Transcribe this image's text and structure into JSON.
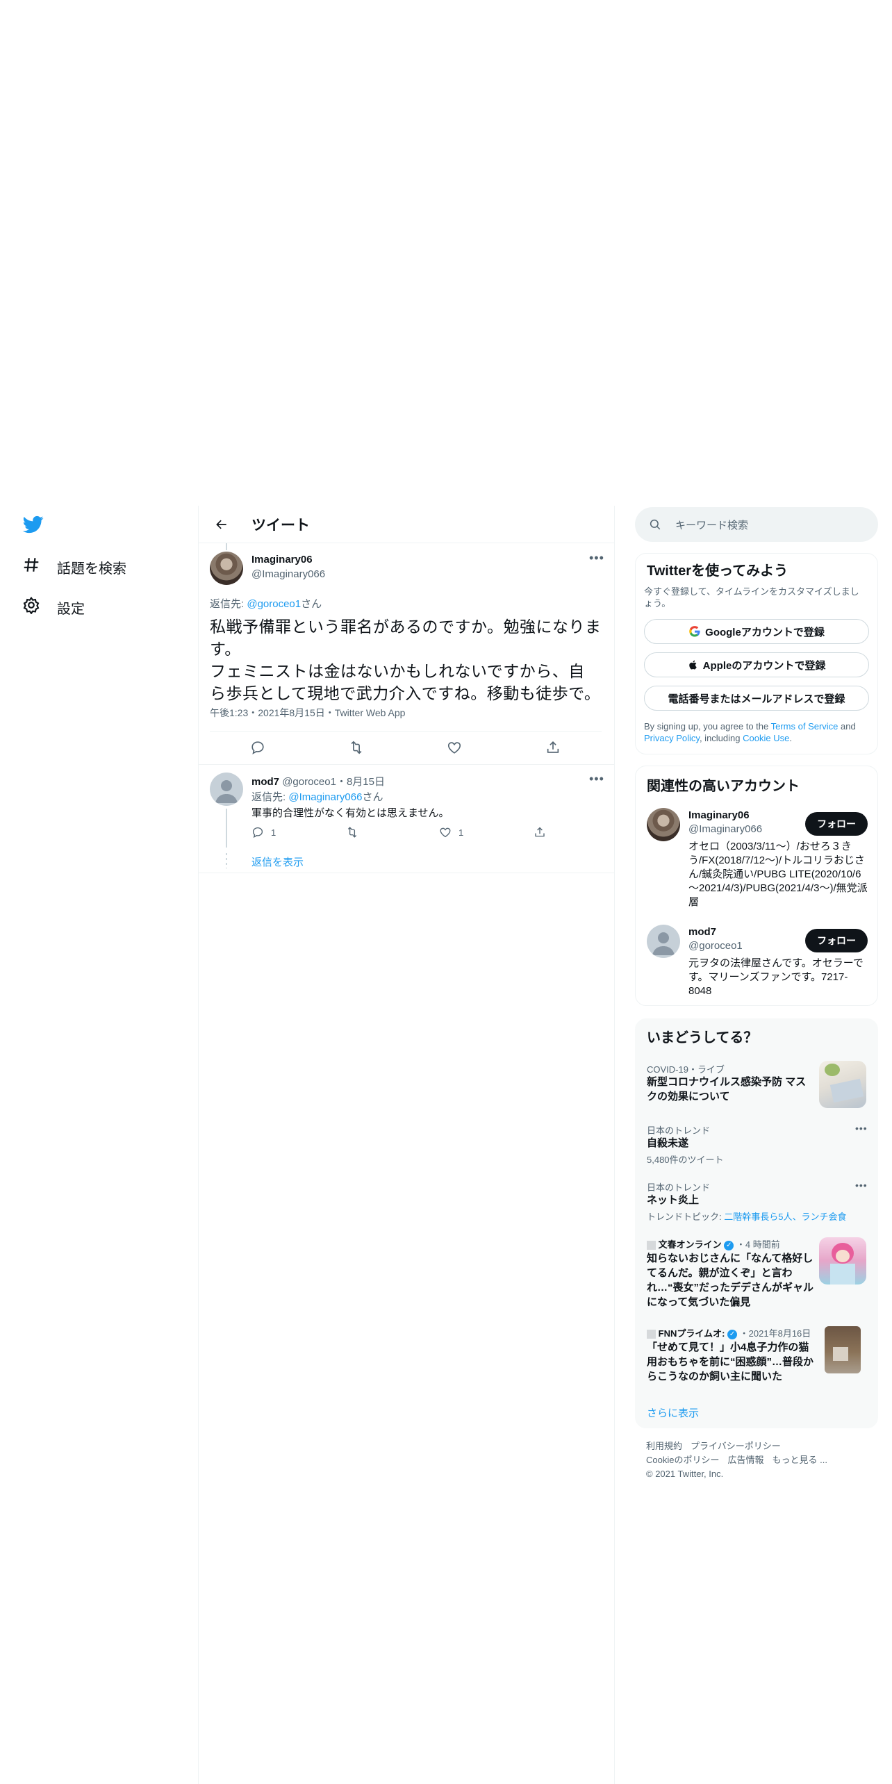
{
  "nav": {
    "explore_label": "話題を検索",
    "settings_label": "設定"
  },
  "header": {
    "title": "ツイート"
  },
  "main_tweet": {
    "display_name": "Imaginary06",
    "handle": "@Imaginary066",
    "reply_prefix": "返信先: ",
    "reply_to": "@goroceo1",
    "reply_suffix": "さん",
    "text_line1": "私戦予備罪という罪名があるのですか。勉強になりま",
    "text_line2": "す。",
    "text_line3": "フェミニストは金はないかもしれないですから、自",
    "text_line4": "ら歩兵として現地で武力介入ですね。移動も徒歩で。",
    "timestamp": "午後1:23・2021年8月15日・Twitter Web App"
  },
  "reply_tweet": {
    "display_name": "mod7",
    "handle_date": "@goroceo1・8月15日",
    "reply_prefix": "返信先: ",
    "reply_to": "@Imaginary066",
    "reply_suffix": "さん",
    "text": "軍事的合理性がなく有効とは思えません。",
    "reply_count": "1",
    "like_count": "1",
    "show_replies": "返信を表示"
  },
  "search": {
    "placeholder": "キーワード検索"
  },
  "signup": {
    "title": "Twitterを使ってみよう",
    "subtitle": "今すぐ登録して、タイムラインをカスタマイズしましょう。",
    "google_label": "Googleアカウントで登録",
    "apple_label": "Appleのアカウントで登録",
    "phone_label": "電話番号またはメールアドレスで登録",
    "terms_prefix": "By signing up, you agree to the ",
    "terms_link": "Terms of Service",
    "terms_and": " and ",
    "privacy_link": "Privacy Policy",
    "including": ", including ",
    "cookie_link": "Cookie Use",
    "period": "."
  },
  "related": {
    "title": "関連性の高いアカウント",
    "follow_label": "フォロー",
    "accounts": [
      {
        "name": "Imaginary06",
        "handle": "@Imaginary066",
        "bio": "オセロ（2003/3/11～）/おせろ３きう/FX(2018/7/12～)/トルコリラおじさん/鍼灸院通い/PUBG LITE(2020/10/6～2021/4/3)/PUBG(2021/4/3～)/無党派層"
      },
      {
        "name": "mod7",
        "handle": "@goroceo1",
        "bio": "元ヲタの法律屋さんです。オセラーです。マリーンズファンです。7217-8048"
      }
    ]
  },
  "trends": {
    "title": "いまどうしてる？",
    "items": [
      {
        "meta": "COVID-19・ライブ",
        "title": "新型コロナウイルス感染予防 マスクの効果について"
      },
      {
        "meta": "日本のトレンド",
        "title": "自殺未遂",
        "sub": "5,480件のツイート"
      },
      {
        "meta": "日本のトレンド",
        "title": "ネット炎上",
        "sub_prefix": "トレンドトピック: ",
        "sub_link": "二階幹事長ら5人、ランチ会食"
      },
      {
        "source": "文春オンライン",
        "time": "・4 時間前",
        "title": "知らないおじさんに「なんて格好してるんだ。親が泣くぞ」と言われ…“喪女”だったデデさんがギャルになって気づいた偏見"
      },
      {
        "source": "FNNプライムオ:",
        "time": "・2021年8月16日",
        "title": "「せめて見て！」小4息子力作の猫用おもちゃを前に“困惑顔”…普段からこうなのか飼い主に聞いた"
      }
    ],
    "show_more": "さらに表示"
  },
  "footer": {
    "terms": "利用規約",
    "privacy": "プライバシーポリシー",
    "cookie": "Cookieのポリシー",
    "ads": "広告情報",
    "more": "もっと見る ...",
    "copyright": "© 2021 Twitter, Inc."
  },
  "colors": {
    "accent": "#1d9bf0",
    "text": "#0f1419",
    "muted": "#536471",
    "border": "#eff3f4"
  }
}
